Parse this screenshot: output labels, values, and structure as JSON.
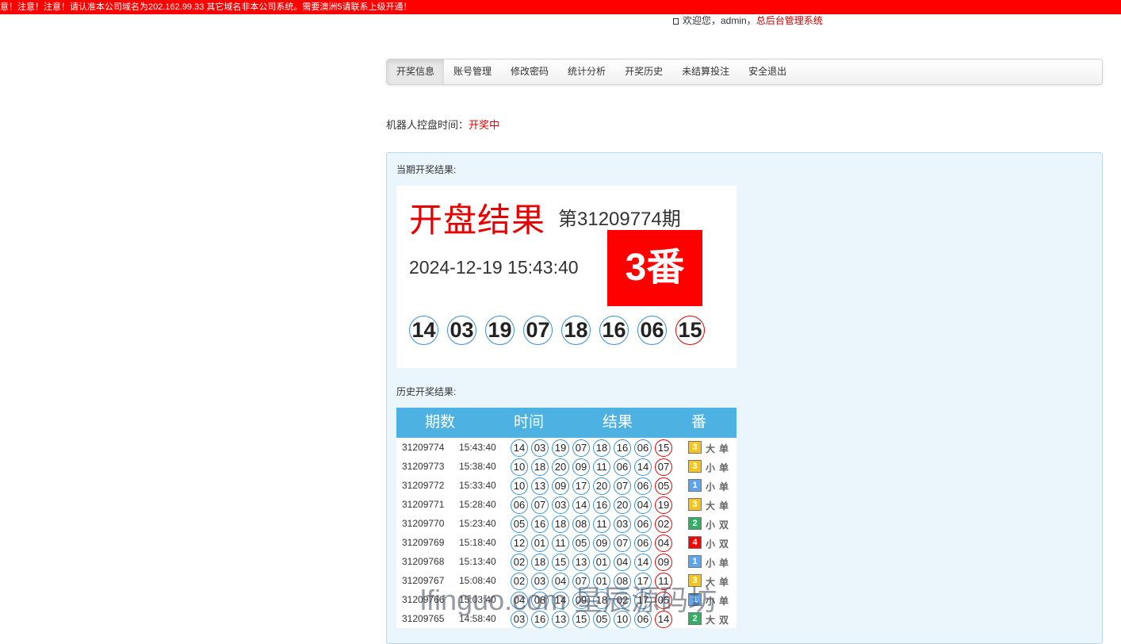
{
  "notice": "意！注意！注意！请认准本公司域名为202.162.99.33 其它域名非本公司系统。需要澳洲5请联系上级开通！",
  "header": {
    "welcome": "欢迎您，admin，",
    "admin_link": "总后台管理系统"
  },
  "nav": {
    "tabs": [
      "开奖信息",
      "账号管理",
      "修改密码",
      "统计分析",
      "开奖历史",
      "未结算投注",
      "安全退出"
    ],
    "active": "开奖信息"
  },
  "robot": {
    "label": "机器人控盘时间：",
    "status": "开奖中"
  },
  "current": {
    "section_label": "当期开奖结果:",
    "title": "开盘结果",
    "period": "第31209774期",
    "datetime": "2024-12-19 15:43:40",
    "fan": "3番",
    "balls": [
      "14",
      "03",
      "19",
      "07",
      "18",
      "16",
      "06",
      "15"
    ]
  },
  "history": {
    "section_label": "历史开奖结果:",
    "headers": {
      "no": "期数",
      "time": "时间",
      "result": "结果",
      "fan": "番"
    },
    "rows": [
      {
        "no": "31209774",
        "time": "15:43:40",
        "balls": [
          "14",
          "03",
          "19",
          "07",
          "18",
          "16",
          "06",
          "15"
        ],
        "fan": "3",
        "size": "大",
        "parity": "单"
      },
      {
        "no": "31209773",
        "time": "15:38:40",
        "balls": [
          "10",
          "18",
          "20",
          "09",
          "11",
          "06",
          "14",
          "07"
        ],
        "fan": "3",
        "size": "小",
        "parity": "单"
      },
      {
        "no": "31209772",
        "time": "15:33:40",
        "balls": [
          "10",
          "13",
          "09",
          "17",
          "20",
          "07",
          "06",
          "05"
        ],
        "fan": "1",
        "size": "小",
        "parity": "单"
      },
      {
        "no": "31209771",
        "time": "15:28:40",
        "balls": [
          "06",
          "07",
          "03",
          "14",
          "16",
          "20",
          "04",
          "19"
        ],
        "fan": "3",
        "size": "大",
        "parity": "单"
      },
      {
        "no": "31209770",
        "time": "15:23:40",
        "balls": [
          "05",
          "16",
          "18",
          "08",
          "11",
          "03",
          "06",
          "02"
        ],
        "fan": "2",
        "size": "小",
        "parity": "双"
      },
      {
        "no": "31209769",
        "time": "15:18:40",
        "balls": [
          "12",
          "01",
          "11",
          "05",
          "09",
          "07",
          "06",
          "04"
        ],
        "fan": "4",
        "size": "小",
        "parity": "双"
      },
      {
        "no": "31209768",
        "time": "15:13:40",
        "balls": [
          "02",
          "18",
          "15",
          "13",
          "01",
          "04",
          "14",
          "09"
        ],
        "fan": "1",
        "size": "小",
        "parity": "单"
      },
      {
        "no": "31209767",
        "time": "15:08:40",
        "balls": [
          "02",
          "03",
          "04",
          "07",
          "01",
          "08",
          "17",
          "11"
        ],
        "fan": "3",
        "size": "大",
        "parity": "单"
      },
      {
        "no": "31209766",
        "time": "15:03:40",
        "balls": [
          "04",
          "08",
          "14",
          "09",
          "18",
          "02",
          "17",
          "05"
        ],
        "fan": "1",
        "size": "小",
        "parity": "单"
      },
      {
        "no": "31209765",
        "time": "14:58:40",
        "balls": [
          "03",
          "16",
          "13",
          "15",
          "05",
          "10",
          "06",
          "14"
        ],
        "fan": "2",
        "size": "大",
        "parity": "双"
      }
    ]
  },
  "watermark": "lfinguo.com 星辰源码坊",
  "colors": {
    "notice_bg": "#ff0000",
    "accent_red": "#e60000",
    "header_blue": "#4db1e2",
    "fan_1": "#5ba6ee",
    "fan_2": "#2fb164",
    "fan_3": "#f5c518",
    "fan_4": "#ff0000",
    "panel_bg": "#eaf5fc"
  }
}
